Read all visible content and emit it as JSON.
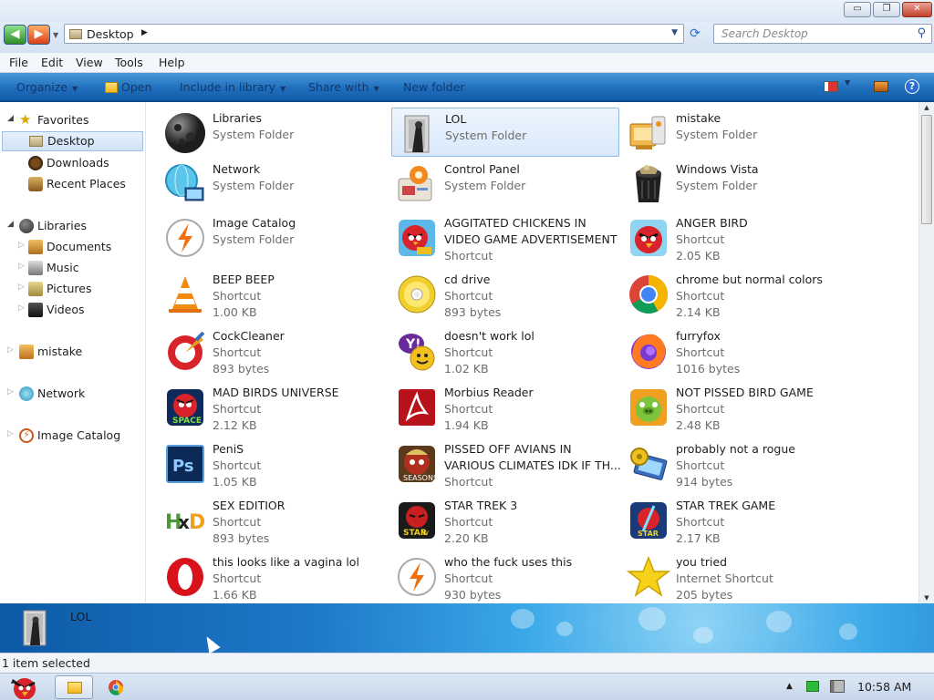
{
  "window": {
    "minimize_symbol": "▭",
    "maximize_symbol": "❐",
    "close_symbol": "✕"
  },
  "address_bar": {
    "path": "Desktop",
    "search_placeholder": "Search Desktop"
  },
  "menu": [
    "File",
    "Edit",
    "View",
    "Tools",
    "Help"
  ],
  "commands": {
    "organize": "Organize",
    "open": "Open",
    "include": "Include in library",
    "share": "Share with",
    "new_folder": "New folder"
  },
  "sidebar": {
    "favorites": "Favorites",
    "desktop": "Desktop",
    "downloads": "Downloads",
    "recent": "Recent Places",
    "libraries": "Libraries",
    "documents": "Documents",
    "music": "Music",
    "pictures": "Pictures",
    "videos": "Videos",
    "mistake": "mistake",
    "network": "Network",
    "image_catalog": "Image Catalog"
  },
  "items": [
    {
      "name": "Libraries",
      "type": "System Folder",
      "size": "",
      "icon": "libraries-icon"
    },
    {
      "name": "LOL",
      "type": "System Folder",
      "size": "",
      "icon": "user-folder-icon"
    },
    {
      "name": "mistake",
      "type": "System Folder",
      "size": "",
      "icon": "computer-icon"
    },
    {
      "name": "Network",
      "type": "System Folder",
      "size": "",
      "icon": "network-icon"
    },
    {
      "name": "Control Panel",
      "type": "System Folder",
      "size": "",
      "icon": "control-panel-icon"
    },
    {
      "name": "Windows Vista",
      "type": "System Folder",
      "size": "",
      "icon": "recycle-bin-icon"
    },
    {
      "name": "Image Catalog",
      "type": "System Folder",
      "size": "",
      "icon": "image-catalog-icon"
    },
    {
      "name": "AGGITATED CHICKENS IN",
      "name2": "VIDEO GAME ADVERTISEMENT",
      "type": "Shortcut",
      "size": "",
      "icon": "angry-birds-rio-icon"
    },
    {
      "name": "ANGER BIRD",
      "type": "Shortcut",
      "size": "2.05 KB",
      "icon": "angry-bird-icon"
    },
    {
      "name": "BEEP BEEP",
      "type": "Shortcut",
      "size": "1.00 KB",
      "icon": "vlc-cone-icon"
    },
    {
      "name": "cd drive",
      "type": "Shortcut",
      "size": "893 bytes",
      "icon": "cd-disc-icon"
    },
    {
      "name": "chrome but normal colors",
      "type": "Shortcut",
      "size": "2.14 KB",
      "icon": "chrome-icon"
    },
    {
      "name": "CockCleaner",
      "type": "Shortcut",
      "size": "893 bytes",
      "icon": "ccleaner-icon"
    },
    {
      "name": "doesn't work lol",
      "type": "Shortcut",
      "size": "1.02 KB",
      "icon": "yahoo-messenger-icon"
    },
    {
      "name": "furryfox",
      "type": "Shortcut",
      "size": "1016 bytes",
      "icon": "firefox-icon"
    },
    {
      "name": "MAD BIRDS UNIVERSE",
      "type": "Shortcut",
      "size": "2.12 KB",
      "icon": "angry-birds-space-icon"
    },
    {
      "name": "Morbius Reader",
      "type": "Shortcut",
      "size": "1.94 KB",
      "icon": "pdf-reader-icon"
    },
    {
      "name": "NOT PISSED BIRD GAME",
      "type": "Shortcut",
      "size": "2.48 KB",
      "icon": "bad-piggies-icon"
    },
    {
      "name": "PeniS",
      "type": "Shortcut",
      "size": "1.05 KB",
      "icon": "photoshop-icon"
    },
    {
      "name": "PISSED OFF AVIANS IN",
      "name2": "VARIOUS CLIMATES IDK IF TH...",
      "type": "Shortcut",
      "size": "",
      "icon": "angry-birds-seasons-icon"
    },
    {
      "name": "probably not a rogue",
      "type": "Shortcut",
      "size": "914 bytes",
      "icon": "settings-computer-icon"
    },
    {
      "name": "SEX EDITIOR",
      "type": "Shortcut",
      "size": "893 bytes",
      "icon": "hxd-editor-icon"
    },
    {
      "name": "STAR TREK 3",
      "type": "Shortcut",
      "size": "2.20 KB",
      "icon": "star-wars-icon"
    },
    {
      "name": "STAR TREK GAME",
      "type": "Shortcut",
      "size": "2.17 KB",
      "icon": "angry-birds-star-wars-icon"
    },
    {
      "name": "this looks like a vagina lol",
      "type": "Shortcut",
      "size": "1.66 KB",
      "icon": "opera-icon"
    },
    {
      "name": "who the fuck uses this",
      "type": "Shortcut",
      "size": "930 bytes",
      "icon": "image-catalog-icon"
    },
    {
      "name": "you tried",
      "type": "Internet Shortcut",
      "size": "205 bytes",
      "icon": "star-icon"
    }
  ],
  "details": {
    "name": "LOL"
  },
  "status": "1 item selected",
  "clock": "10:58 AM"
}
